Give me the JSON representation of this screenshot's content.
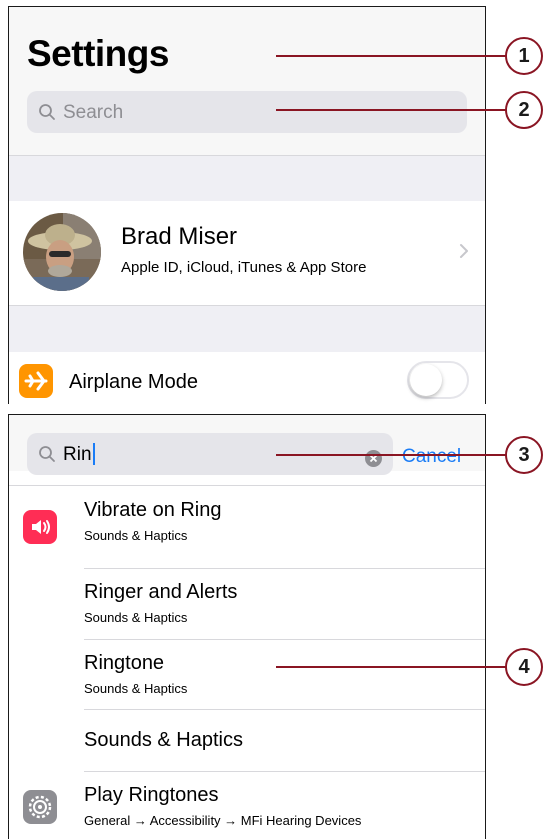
{
  "top_panel": {
    "title": "Settings",
    "search": {
      "placeholder": "Search"
    },
    "profile": {
      "name": "Brad Miser",
      "subtitle": "Apple ID, iCloud, iTunes & App Store"
    },
    "airplane": {
      "label": "Airplane Mode",
      "toggle_on": false
    }
  },
  "bottom_panel": {
    "search": {
      "value": "Rin",
      "cancel_label": "Cancel"
    },
    "results": [
      {
        "title": "Vibrate on Ring",
        "subtitle": "Sounds & Haptics",
        "icon": "sound-icon"
      },
      {
        "title": "Ringer and Alerts",
        "subtitle": "Sounds & Haptics",
        "icon": ""
      },
      {
        "title": "Ringtone",
        "subtitle": "Sounds & Haptics",
        "icon": ""
      },
      {
        "title": "Sounds & Haptics",
        "subtitle": "",
        "icon": ""
      },
      {
        "title": "Play Ringtones",
        "subtitle": "General → Accessibility → MFi Hearing Devices",
        "icon": "gear-icon"
      }
    ]
  },
  "callouts": [
    "1",
    "2",
    "3",
    "4"
  ],
  "colors": {
    "callout": "#8a1523",
    "link_blue": "#1a7cf6",
    "airplane_orange": "#ff9500",
    "sound_pink": "#ff2d55",
    "gear_gray": "#8e8e93"
  }
}
